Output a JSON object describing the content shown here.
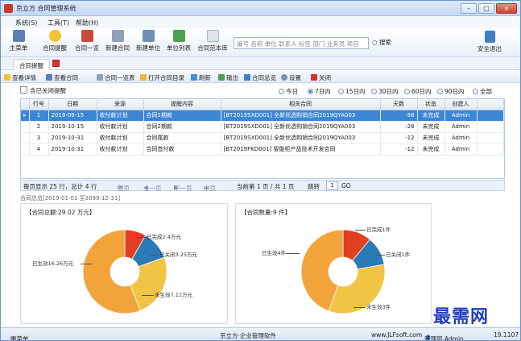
{
  "window": {
    "title": "京立方 合同管理系统",
    "min": "–",
    "max": "□",
    "close": "×"
  },
  "menu": [
    "系统(S)",
    "工具(T)",
    "帮助(H)"
  ],
  "toolbar": [
    "主菜单",
    "合同提醒",
    "合同一览",
    "新建合同",
    "新建单位",
    "单位列表",
    "合同范本库"
  ],
  "search": {
    "placeholder": "编号 名称 单位 联系人 标签 部门 业务员 项目",
    "button": "搜索"
  },
  "logout": "安全退出",
  "tab": {
    "label": "合同提醒"
  },
  "subbar": [
    "查看详情",
    "查看合同",
    "合同一览表",
    "打开合同目录",
    "刷新",
    "输出",
    "合同总览",
    "设置",
    "关闭"
  ],
  "filters": {
    "include_closed": "含已关闭提醒",
    "options": [
      "今日",
      "7日内",
      "15日内",
      "30日内",
      "60日内",
      "90日内",
      "全部"
    ],
    "selected": "7日内"
  },
  "grid": {
    "headers": [
      "行号",
      "日期",
      "来源",
      "提醒内容",
      "相关合同",
      "天数",
      "状态",
      "创建人"
    ],
    "rows": [
      [
        "1",
        "2019-09-15",
        "收付款计划",
        "合同1期款",
        "[BT2019SXD001] 全新优选购销合同2019QYA003",
        "-58",
        "未完成",
        "Admin"
      ],
      [
        "2",
        "2019-10-15",
        "收付款计划",
        "合同2期款",
        "[BT2019SXD001] 全新优选购销合同2019QYA003",
        "-28",
        "未完成",
        "Admin"
      ],
      [
        "3",
        "2019-10-31",
        "收付款计划",
        "合同尾款",
        "[BT2019SXD001] 全新优选购销合同2019QYA003",
        "-12",
        "未完成",
        "Admin"
      ],
      [
        "4",
        "2019-10-31",
        "收付款计划",
        "合同首付款",
        "[BT2019FKD001] 智能柜产品技术开发合同",
        "-12",
        "未完成",
        "Admin"
      ]
    ]
  },
  "pager": {
    "per_page": "每页显示  25  行，总计  4  行",
    "first": "首页",
    "prev": "上一页",
    "next": "下一页",
    "last": "末页",
    "current": "当前第  1  页 / 共  1  页",
    "jump": "跳转",
    "page": "1",
    "go": "GO"
  },
  "period": "合同总览[2019-01-01 至2099-12-31]",
  "chart_data": [
    {
      "type": "pie",
      "title": "【合同总额:29.02 万元】",
      "unit": "万元",
      "slices": [
        {
          "name": "已完成",
          "value": 2.4,
          "label": "已完成2.4万元"
        },
        {
          "name": "已关闭",
          "value": 3.25,
          "label": "已关闭3.25万元"
        },
        {
          "name": "未生效",
          "value": 7.11,
          "label": "未生效7.11万元"
        },
        {
          "name": "已生效",
          "value": 16.26,
          "label": "已生效16.26万元"
        }
      ]
    },
    {
      "type": "pie",
      "title": "【合同数量:9 件】",
      "unit": "件",
      "slices": [
        {
          "name": "已完成",
          "value": 1,
          "label": "已完成1件"
        },
        {
          "name": "已关闭",
          "value": 1,
          "label": "已关闭1件"
        },
        {
          "name": "未生效",
          "value": 3,
          "label": "未生效3件"
        },
        {
          "name": "已生效",
          "value": 4,
          "label": "已生效4件"
        }
      ]
    }
  ],
  "colors": {
    "completed": "#e0401f",
    "closed": "#2a7ab8",
    "pending": "#f0c445",
    "active": "#f2a43a"
  },
  "watermark": "最需网",
  "status": {
    "menu": "主菜单",
    "center": "京立方·企业管理软件",
    "site": "www.JLFsoft.com",
    "user": "管理部 Admin",
    "version": "19.1107"
  }
}
